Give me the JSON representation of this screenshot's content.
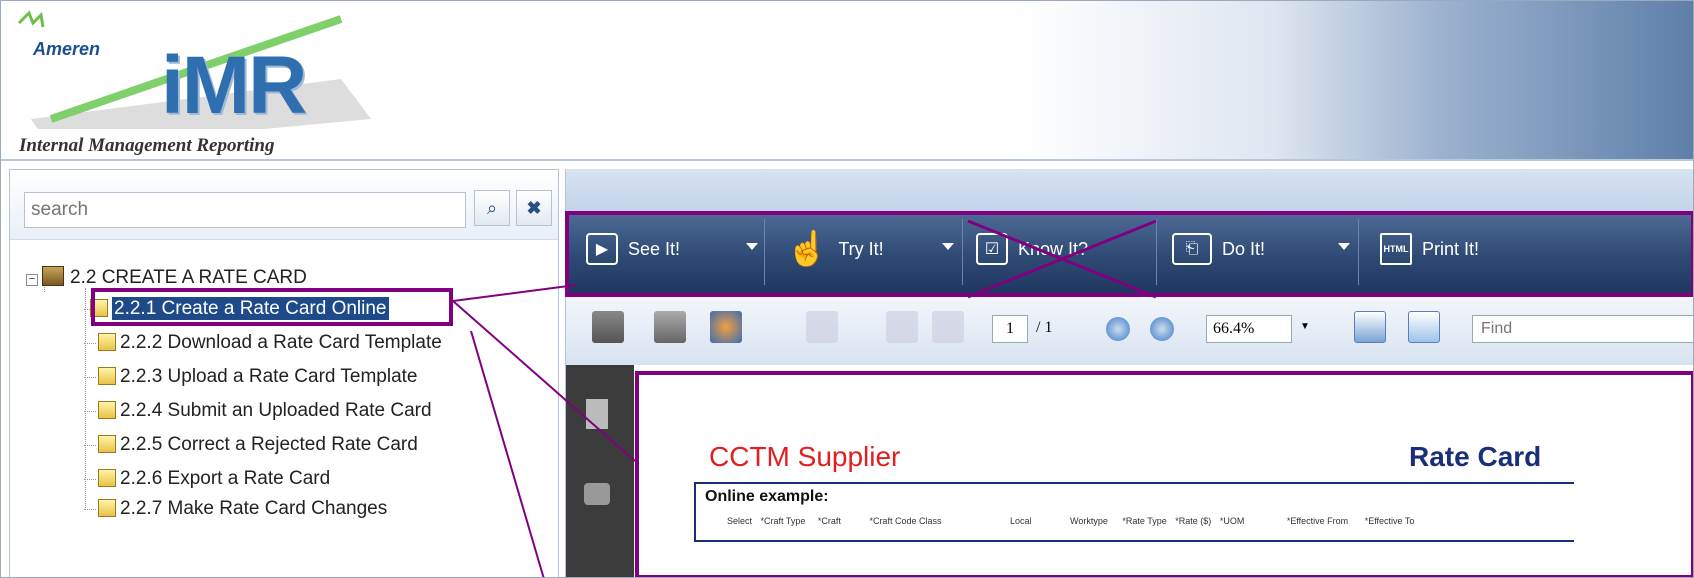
{
  "header": {
    "logo_brand": "Ameren",
    "logo_title": "iMR",
    "logo_subtitle": "Internal Management Reporting"
  },
  "search": {
    "placeholder": "search"
  },
  "tree": {
    "chapter_label": "2.2 CREATE A RATE CARD",
    "items": [
      {
        "label": "2.2.1 Create a Rate Card Online",
        "selected": true
      },
      {
        "label": "2.2.2  Download a Rate Card Template"
      },
      {
        "label": "2.2.3  Upload a Rate Card Template"
      },
      {
        "label": "2.2.4  Submit an Uploaded Rate Card"
      },
      {
        "label": "2.2.5  Correct a Rejected Rate Card"
      },
      {
        "label": "2.2.6  Export a Rate Card"
      },
      {
        "label": "2.2.7  Make Rate Card Changes"
      }
    ]
  },
  "toolbar": {
    "see_it": "See It!",
    "try_it": "Try It!",
    "know_it": "Know It?",
    "do_it": "Do It!",
    "print_it": "Print It!",
    "print_icon_text": "HTML"
  },
  "pdf": {
    "current_page": "1",
    "total_pages": "/ 1",
    "zoom": "66.4%",
    "find_placeholder": "Find"
  },
  "document": {
    "supplier_title": "CCTM Supplier",
    "rate_card_title": "Rate Card",
    "online_example": "Online example:",
    "columns": [
      "Select",
      "*Craft Type",
      "*Craft",
      "*Craft Code Class",
      "Local",
      "Worktype",
      "*Rate Type",
      "*Rate ($)",
      "*UOM",
      "*Effective From",
      "*Effective To"
    ]
  },
  "colors": {
    "highlight": "#800080",
    "toolbar_bg": "#2f4a75",
    "supplier_red": "#e02020",
    "rate_card_blue": "#1a2f7a"
  }
}
